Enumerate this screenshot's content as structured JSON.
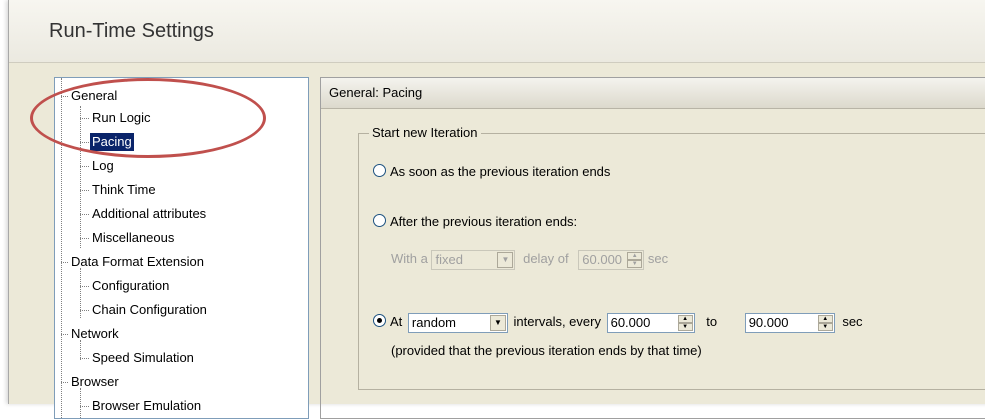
{
  "window": {
    "title": "Run-Time Settings"
  },
  "tree": {
    "items": [
      {
        "label": "General"
      },
      {
        "label": "Run Logic"
      },
      {
        "label": "Pacing"
      },
      {
        "label": "Log"
      },
      {
        "label": "Think Time"
      },
      {
        "label": "Additional attributes"
      },
      {
        "label": "Miscellaneous"
      },
      {
        "label": "Data Format Extension"
      },
      {
        "label": "Configuration"
      },
      {
        "label": "Chain Configuration"
      },
      {
        "label": "Network"
      },
      {
        "label": "Speed Simulation"
      },
      {
        "label": "Browser"
      },
      {
        "label": "Browser Emulation"
      }
    ],
    "selected": "Pacing"
  },
  "panel": {
    "header": "General: Pacing",
    "group_label": "Start new Iteration",
    "option1": "As soon as the previous iteration ends",
    "option2": "After the previous iteration ends:",
    "option2_sub": {
      "with_a": "With a",
      "select": "fixed",
      "delay_of": "delay of",
      "value": "60.000",
      "sec": "sec"
    },
    "option3": {
      "at": "At",
      "select": "random",
      "intervals_every": "intervals, every",
      "from": "60.000",
      "to": "to",
      "to_value": "90.000",
      "sec": "sec"
    },
    "note": "(provided that the previous iteration ends by that time)",
    "selected_option": 3
  },
  "annotation_color": "#c0504d"
}
